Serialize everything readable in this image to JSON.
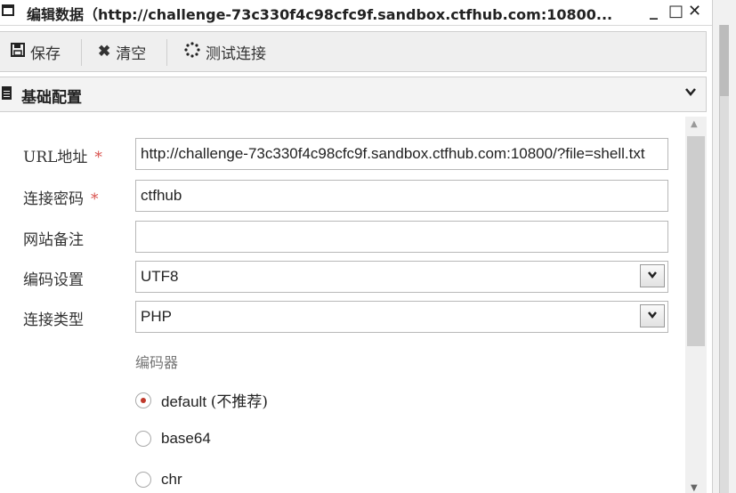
{
  "window": {
    "title": "编辑数据（http://challenge-73c330f4c98cfc9f.sandbox.ctfhub.com:10800...",
    "minimize": "_",
    "maximize": "□",
    "close": "✕"
  },
  "toolbar": {
    "save_label": "保存",
    "clear_label": "清空",
    "test_label": "测试连接"
  },
  "section": {
    "title": "基础配置",
    "toggle": "⌄"
  },
  "form": {
    "url": {
      "label": "URL地址",
      "required": "*",
      "value": "http://challenge-73c330f4c98cfc9f.sandbox.ctfhub.com:10800/?file=shell.txt"
    },
    "password": {
      "label": "连接密码",
      "required": "*",
      "value": "ctfhub"
    },
    "note": {
      "label": "网站备注",
      "value": ""
    },
    "encoding": {
      "label": "编码设置",
      "value": "UTF8"
    },
    "type": {
      "label": "连接类型",
      "value": "PHP"
    },
    "encoder": {
      "label": "编码器",
      "options": [
        {
          "label": "default",
          "suffix": "(不推荐)",
          "checked": true
        },
        {
          "label": "base64",
          "checked": false
        },
        {
          "label": "chr",
          "checked": false
        }
      ]
    }
  },
  "icons": {
    "window": "window-icon",
    "save": "floppy-disk-icon",
    "clear": "x-icon",
    "test": "spinner-icon",
    "section": "document-icon"
  }
}
